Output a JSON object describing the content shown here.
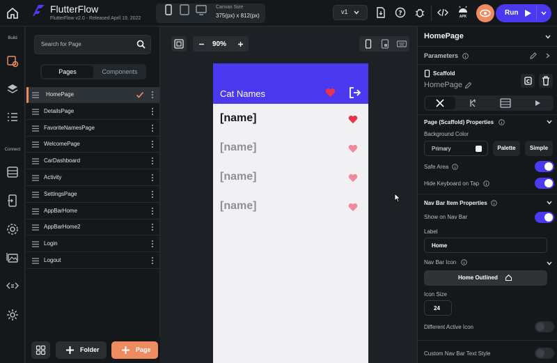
{
  "app": {
    "title": "FlutterFlow",
    "version_text": "FlutterFlow v2.0 - Released April 19, 2022",
    "canvas_size_label": "Canvas Size",
    "canvas_size_value": "375(px) x 812(px)",
    "version_selector": "v1",
    "run_label": "Run",
    "apk_label": "APK"
  },
  "navrail": {
    "build_label": "Build",
    "connect_label": "Connect"
  },
  "pages_panel": {
    "search_placeholder": "Search for Page",
    "tab_pages": "Pages",
    "tab_components": "Components",
    "pages": [
      "HomePage",
      "DetailsPage",
      "FavoriteNamesPage",
      "WelcomePage",
      "CarDashboard",
      "Activity",
      "SettingsPage",
      "AppBarHome",
      "AppBarHome2",
      "Login",
      "Logout"
    ],
    "selected_page": "HomePage",
    "folder_button": "Folder",
    "page_button": "Page"
  },
  "canvas": {
    "zoom": "90%",
    "app_bar_title": "Cat Names",
    "rows": [
      "[name]",
      "[name]",
      "[name]",
      "[name]"
    ]
  },
  "properties": {
    "page_name_header": "HomePage",
    "parameters_label": "Parameters",
    "widget_type": "Scaffold",
    "widget_name": "HomePage",
    "section_page_props": "Page (Scaffold) Properties",
    "background_color_label": "Background Color",
    "background_color_value": "Primary",
    "palette_button": "Palette",
    "simple_button": "Simple",
    "safe_area_label": "Safe Area",
    "hide_keyboard_label": "Hide Keyboard on Tap",
    "section_nav_bar": "Nav Bar Item Properties",
    "show_on_nav_bar_label": "Show on Nav Bar",
    "label_label": "Label",
    "label_value": "Home",
    "nav_bar_icon_label": "Nav Bar Icon",
    "nav_bar_icon_value": "Home Outlined",
    "icon_size_label": "Icon Size",
    "icon_size_value": "24",
    "different_active_icon_label": "Different Active Icon",
    "custom_nav_text_style_label": "Custom Nav Bar Text Style"
  },
  "colors": {
    "primary": "#4b39ef",
    "accent_orange": "#ee8b60",
    "heart_red": "#e7344a",
    "heart_pink": "#f08a9a"
  }
}
